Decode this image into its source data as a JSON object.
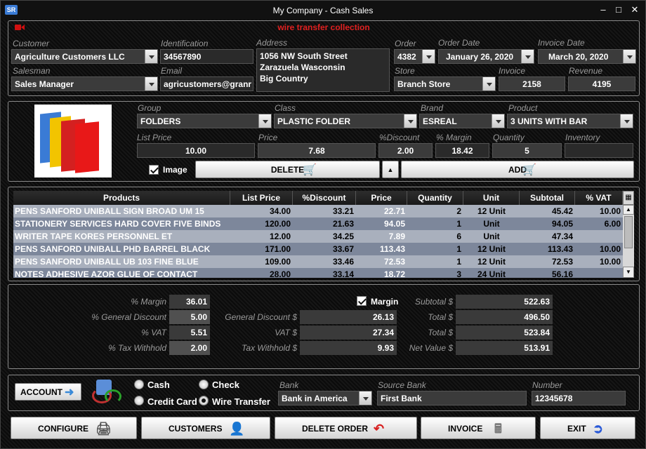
{
  "window": {
    "logo": "SR",
    "title": "My Company - Cash Sales",
    "min": "–",
    "max": "□",
    "close": "✕"
  },
  "notice": "wire transfer collection",
  "header": {
    "customer_label": "Customer",
    "customer": "Agriculture Customers LLC",
    "identification_label": "Identification",
    "identification": "34567890",
    "address_label": "Address",
    "address_lines": [
      "1056 NW South Street",
      "Zarazuela Wasconsin",
      "Big Country"
    ],
    "order_label": "Order",
    "order": "4382",
    "order_date_label": "Order Date",
    "order_date": "January 26, 2020",
    "invoice_date_label": "Invoice Date",
    "invoice_date": "March 20, 2020",
    "salesman_label": "Salesman",
    "salesman": "Sales Manager",
    "email_label": "Email",
    "email": "agricustomers@granr",
    "store_label": "Store",
    "store": "Branch Store",
    "invoice_label": "Invoice",
    "invoice": "2158",
    "revenue_label": "Revenue",
    "revenue": "4195"
  },
  "product": {
    "group_label": "Group",
    "group": "FOLDERS",
    "class_label": "Class",
    "class": "PLASTIC FOLDER",
    "brand_label": "Brand",
    "brand": "ESREAL",
    "product_label": "Product",
    "product": "3 UNITS WITH BAR",
    "list_price_label": "List Price",
    "list_price": "10.00",
    "price_label": "Price",
    "price": "7.68",
    "discount_label": "%Discount",
    "discount": "2.00",
    "margin_label": "% Margin",
    "margin": "18.42",
    "quantity_label": "Quantity",
    "quantity": "5",
    "inventory_label": "Inventory",
    "inventory": "",
    "image_label": "Image",
    "delete_label": "DELETE",
    "add_label": "ADD",
    "image_checked": true
  },
  "grid": {
    "columns": [
      "Products",
      "List Price",
      "%Discount",
      "Price",
      "Quantity",
      "Unit",
      "Subtotal",
      "% VAT"
    ],
    "rows": [
      {
        "product": "PENS SANFORD UNIBALL SIGN BROAD UM 15",
        "list_price": "34.00",
        "discount": "33.21",
        "price": "22.71",
        "quantity": "2",
        "unit": "12 Unit",
        "subtotal": "45.42",
        "vat": "10.00"
      },
      {
        "product": "STATIONERY SERVICES HARD COVER FIVE BINDS",
        "list_price": "120.00",
        "discount": "21.63",
        "price": "94.05",
        "quantity": "1",
        "unit": "Unit",
        "subtotal": "94.05",
        "vat": "6.00"
      },
      {
        "product": "WRITER TAPE KORES PERSONNEL ET",
        "list_price": "12.00",
        "discount": "34.25",
        "price": "7.89",
        "quantity": "6",
        "unit": "Unit",
        "subtotal": "47.34",
        "vat": ""
      },
      {
        "product": "PENS SANFORD UNIBALL PHD BARREL BLACK",
        "list_price": "171.00",
        "discount": "33.67",
        "price": "113.43",
        "quantity": "1",
        "unit": "12 Unit",
        "subtotal": "113.43",
        "vat": "10.00"
      },
      {
        "product": "PENS SANFORD UNIBALL UB 103 FINE BLUE",
        "list_price": "109.00",
        "discount": "33.46",
        "price": "72.53",
        "quantity": "1",
        "unit": "12 Unit",
        "subtotal": "72.53",
        "vat": "10.00"
      },
      {
        "product": "NOTES ADHESIVE AZOR GLUE OF CONTACT",
        "list_price": "28.00",
        "discount": "33.14",
        "price": "18.72",
        "quantity": "3",
        "unit": "24 Unit",
        "subtotal": "56.16",
        "vat": ""
      }
    ]
  },
  "summary": {
    "margin_pct_label": "% Margin",
    "margin_pct": "36.01",
    "gen_disc_pct_label": "% General Discount",
    "gen_disc_pct": "5.00",
    "vat_pct_label": "% VAT",
    "vat_pct": "5.51",
    "tax_pct_label": "% Tax Withhold",
    "tax_pct": "2.00",
    "margin_check_label": "Margin",
    "gen_disc_amt_label": "General Discount $",
    "gen_disc_amt": "26.13",
    "vat_amt_label": "VAT $",
    "vat_amt": "27.34",
    "tax_amt_label": "Tax Withhold $",
    "tax_amt": "9.93",
    "subtotal_label": "Subtotal $",
    "subtotal": "522.63",
    "total1_label": "Total $",
    "total1": "496.50",
    "total2_label": "Total $",
    "total2": "523.84",
    "net_label": "Net Value $",
    "net": "513.91"
  },
  "payment": {
    "account_label": "ACCOUNT",
    "cash": "Cash",
    "check": "Check",
    "credit_card": "Credit Card",
    "wire_transfer": "Wire Transfer",
    "selected": "wire_transfer",
    "bank_label": "Bank",
    "bank": "Bank in America",
    "source_bank_label": "Source Bank",
    "source_bank": "First Bank",
    "number_label": "Number",
    "number": "12345678"
  },
  "footer": {
    "configure": "CONFIGURE",
    "customers": "CUSTOMERS",
    "delete_order": "DELETE ORDER",
    "invoice": "INVOICE",
    "exit": "EXIT"
  },
  "colors": {
    "notice": "#e02020",
    "grid_odd": "#a9b0bd",
    "grid_even": "#7d879b"
  }
}
